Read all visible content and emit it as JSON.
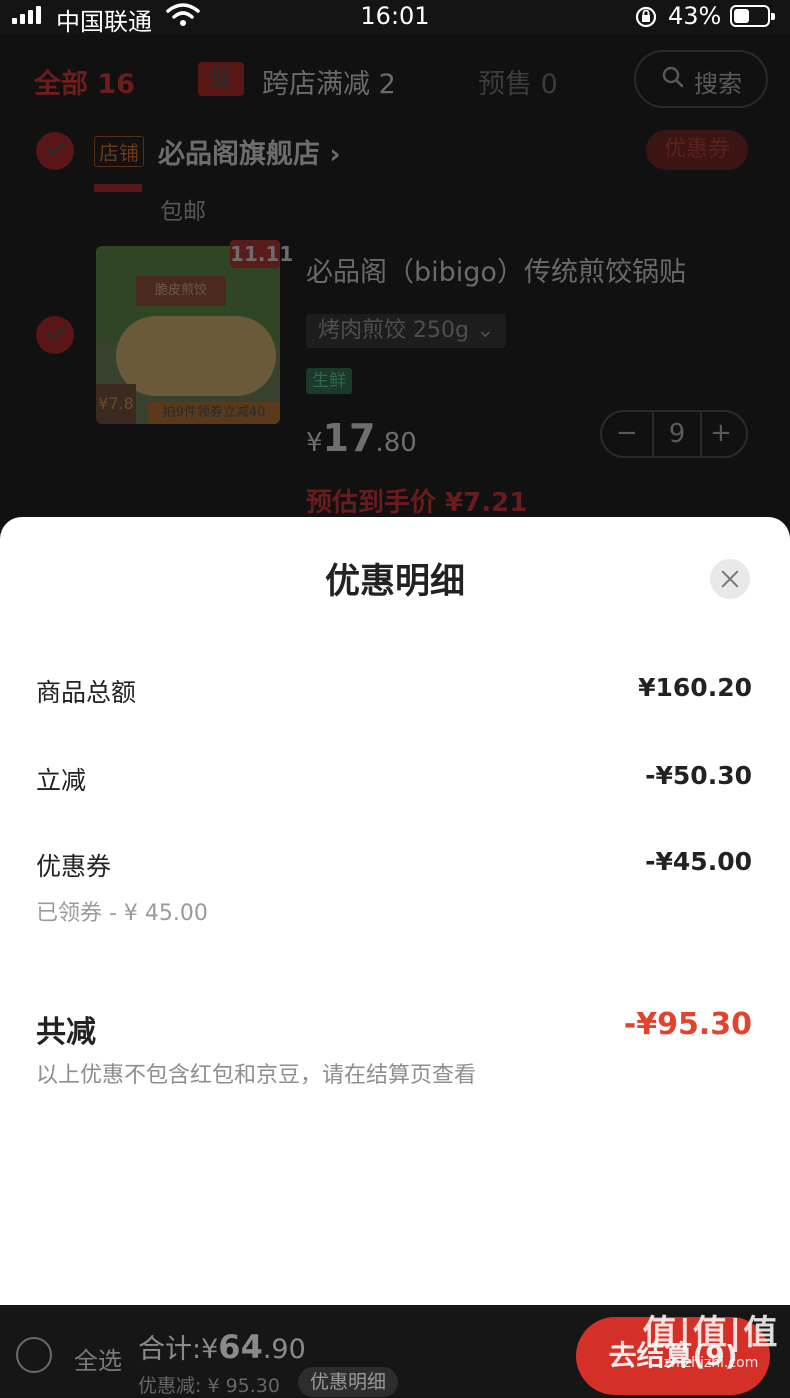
{
  "status_bar": {
    "carrier": "中国联通",
    "time": "16:01",
    "battery": "43%"
  },
  "cart": {
    "tabs": {
      "all": "全部 16",
      "promo_tag": "促",
      "promo": "跨店满减 2",
      "presale": "预售 0"
    },
    "search_label": "搜索",
    "store": {
      "badge": "店铺",
      "name": "必品阁旗舰店 ›",
      "coupon": "优惠券"
    },
    "shipping_note": "包邮",
    "product": {
      "badge": "11.11",
      "image_badge_text": "脆皮煎饺",
      "image_price": "¥7.8",
      "image_promo": "拍9件领券立减40",
      "title": "必品阁（bibigo）传统煎饺锅贴",
      "variant": "烤肉煎饺 250g ⌄",
      "fresh_tag": "生鲜",
      "price_symbol": "¥",
      "price_int": "17",
      "price_dec": ".80",
      "quantity": "9",
      "minus": "−",
      "plus": "+",
      "estimated_price": "预估到手价 ¥7.21"
    }
  },
  "sheet": {
    "title": "优惠明细",
    "rows": [
      {
        "label": "商品总额",
        "value": "¥160.20"
      },
      {
        "label": "立减",
        "value": "-¥50.30"
      },
      {
        "label": "优惠券",
        "value": "-¥45.00",
        "sub": "已领券 - ¥ 45.00"
      }
    ],
    "total_label": "共减",
    "total_value": "-¥95.30",
    "note": "以上优惠不包含红包和京豆，请在结算页查看"
  },
  "bottom": {
    "select_all": "全选",
    "sum_prefix": "合计:",
    "sum_symbol": "¥",
    "sum_int": "64",
    "sum_dec": ".90",
    "discount_line": "优惠减: ¥ 95.30",
    "detail_chip": "优惠明细",
    "checkout": "去结算(9)"
  },
  "watermark": {
    "big": "值|值|值",
    "small": "zhizhizhi.com"
  },
  "colors": {
    "accent_red": "#e2432c",
    "checkout_red": "#e6332a",
    "overlay_dark": "#111111"
  }
}
